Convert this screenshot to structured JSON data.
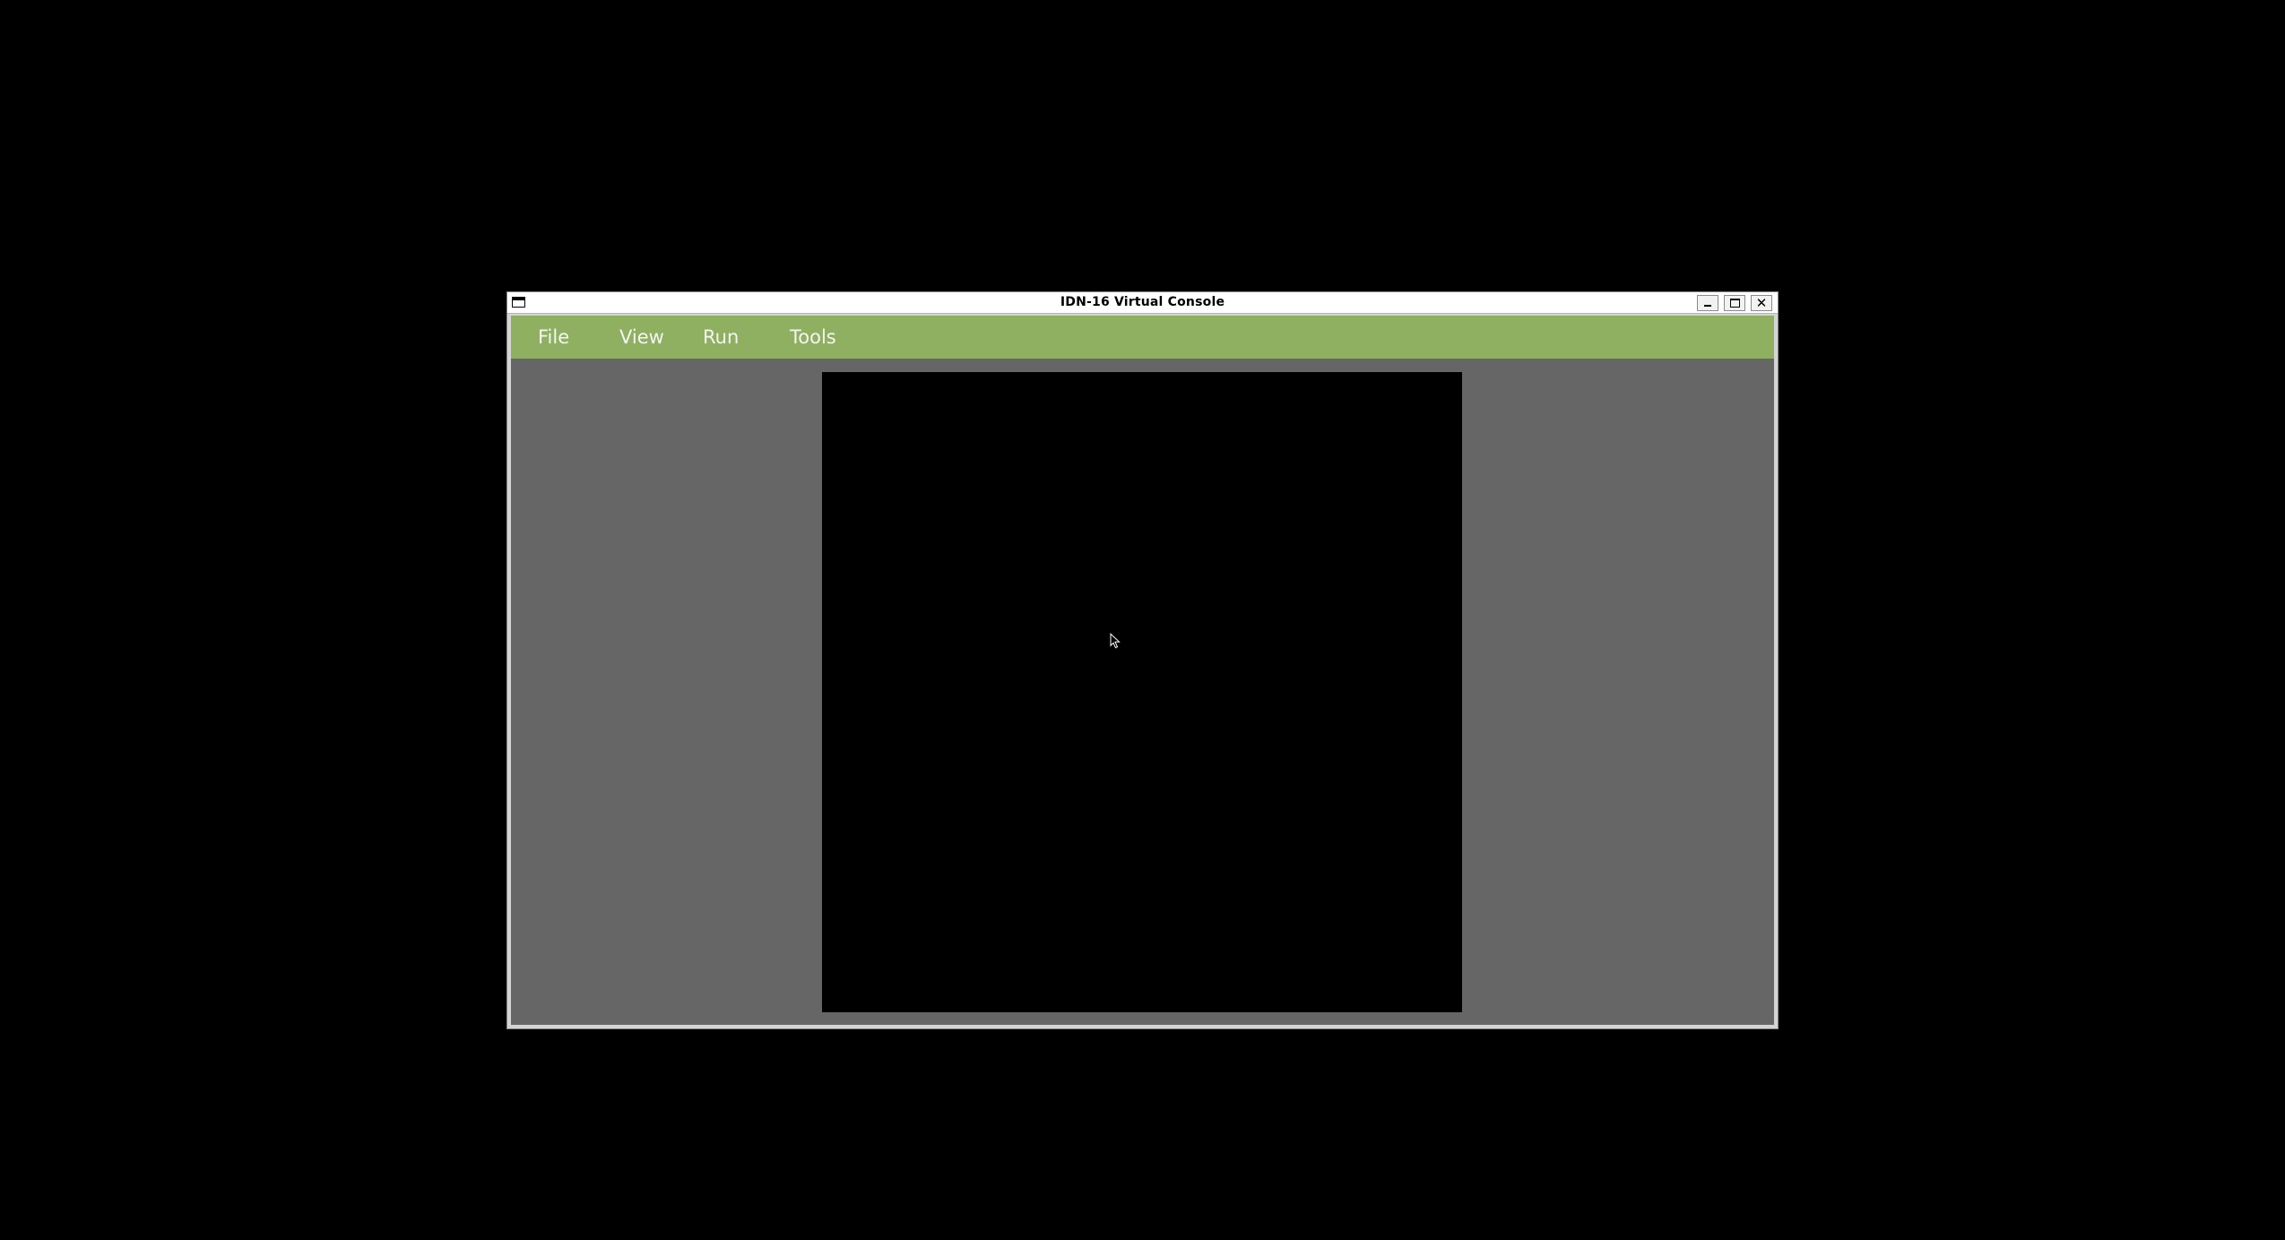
{
  "window": {
    "title": "IDN-16 Virtual Console"
  },
  "menubar": {
    "items": [
      {
        "label": "File"
      },
      {
        "label": "View"
      },
      {
        "label": "Run"
      },
      {
        "label": "Tools"
      }
    ]
  },
  "titlebar_buttons": {
    "close_glyph": "✕"
  },
  "icons": {
    "window_menu": "window-menu-icon",
    "minimize": "minimize-icon",
    "maximize": "maximize-icon",
    "close": "close-icon",
    "cursor": "mouse-pointer-icon"
  },
  "colors": {
    "desktop": "#000000",
    "menubar": "#8fb060",
    "menu_text": "#f4f4f4",
    "client_background": "#666666",
    "console_screen": "#000000"
  }
}
